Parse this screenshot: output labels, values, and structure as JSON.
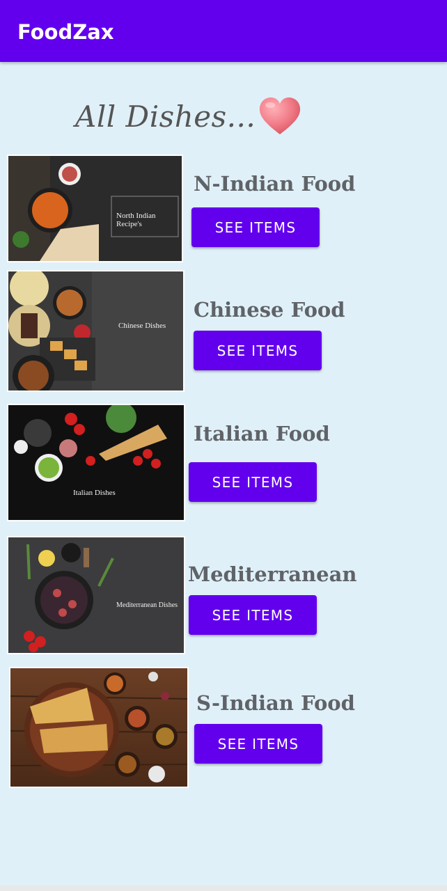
{
  "app_bar": {
    "title": "FoodZax"
  },
  "heading": {
    "text": "All Dishes...",
    "icon": "heart-icon"
  },
  "dishes": [
    {
      "title": "N-Indian Food",
      "button_label": "SEE ITEMS",
      "image_caption": "North Indian Recipe's"
    },
    {
      "title": "Chinese Food",
      "button_label": "SEE ITEMS",
      "image_caption": "Chinese Dishes"
    },
    {
      "title": "Italian Food",
      "button_label": "SEE ITEMS",
      "image_caption": "Italian Dishes"
    },
    {
      "title": "Mediterranean",
      "button_label": "SEE ITEMS",
      "image_caption": "Mediterranean Dishes"
    },
    {
      "title": "S-Indian Food",
      "button_label": "SEE ITEMS",
      "image_caption": ""
    }
  ],
  "colors": {
    "primary": "#6200ee",
    "background": "#e0f0f8",
    "title_text": "#5f6368"
  }
}
